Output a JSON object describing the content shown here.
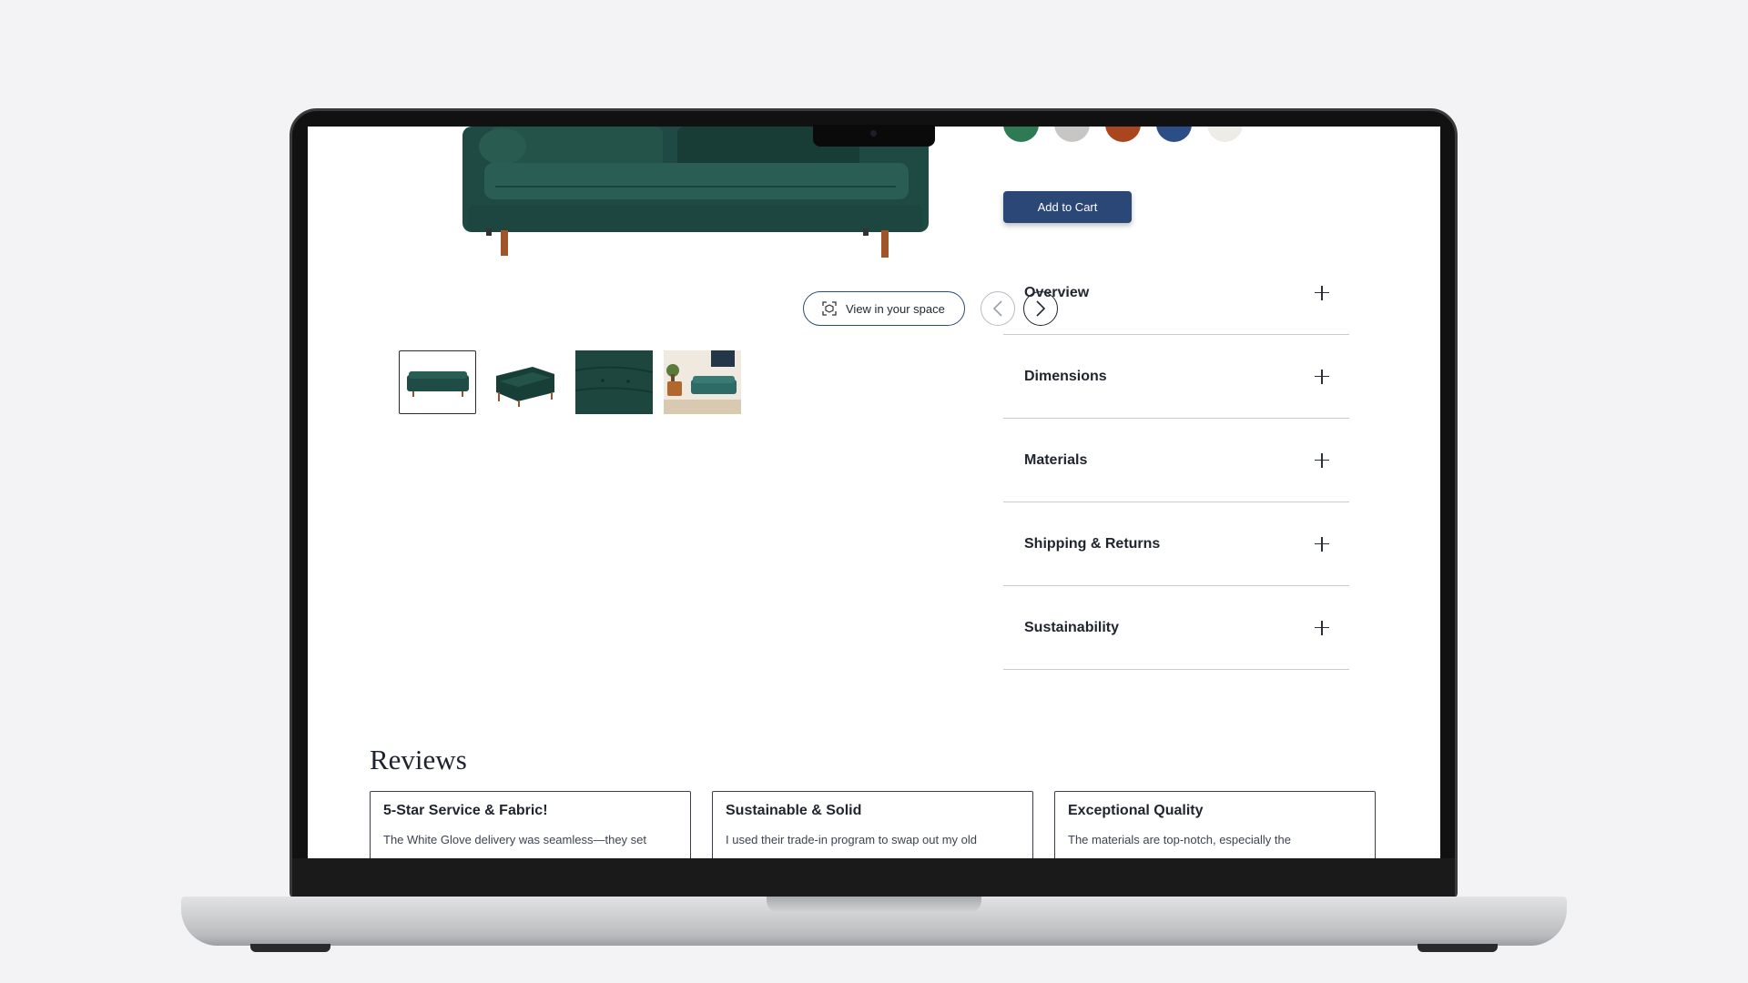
{
  "product": {
    "view_in_space_label": "View in your space",
    "add_to_cart_label": "Add to Cart",
    "swatches": [
      {
        "name": "green",
        "color": "#2e7a55"
      },
      {
        "name": "light-gray",
        "color": "#c8c6c5"
      },
      {
        "name": "rust",
        "color": "#a9461d"
      },
      {
        "name": "navy-blue",
        "color": "#2c4d86"
      },
      {
        "name": "cream",
        "color": "#eeece7"
      }
    ]
  },
  "accordion": [
    {
      "label": "Overview"
    },
    {
      "label": "Dimensions"
    },
    {
      "label": "Materials"
    },
    {
      "label": "Shipping & Returns"
    },
    {
      "label": "Sustainability"
    }
  ],
  "reviews": {
    "title": "Reviews",
    "items": [
      {
        "title": "5-Star Service & Fabric!",
        "body": "The White Glove delivery was seamless—they set"
      },
      {
        "title": "Sustainable & Solid",
        "body": "I used their trade-in program to swap out my old"
      },
      {
        "title": "Exceptional Quality",
        "body": "The materials are top-notch, especially the"
      }
    ]
  },
  "colors": {
    "accent": "#2b4775",
    "sofa_green": "#1f4d45"
  }
}
